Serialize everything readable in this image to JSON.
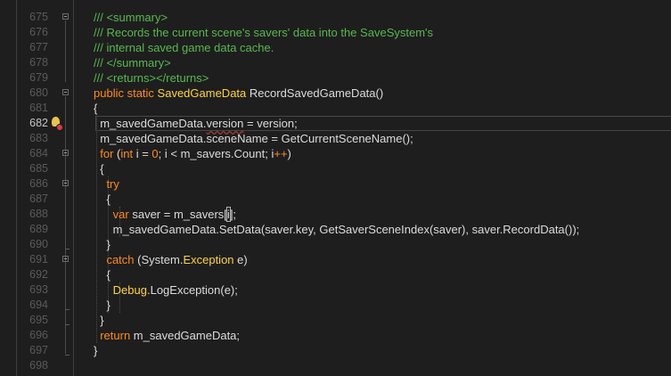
{
  "editor": {
    "line_numbers": [
      "675",
      "676",
      "677",
      "678",
      "679",
      "680",
      "681",
      "682",
      "683",
      "684",
      "685",
      "686",
      "687",
      "688",
      "689",
      "690",
      "691",
      "692",
      "693",
      "694",
      "695",
      "696",
      "697",
      "698"
    ],
    "current_line": "682",
    "lines": [
      {
        "tokens": [
          [
            "d",
            "/// <summary>"
          ]
        ]
      },
      {
        "tokens": [
          [
            "d",
            "/// Records the current scene's savers' data into the SaveSystem's"
          ]
        ]
      },
      {
        "tokens": [
          [
            "d",
            "/// internal saved game data cache."
          ]
        ]
      },
      {
        "tokens": [
          [
            "d",
            "/// </summary>"
          ]
        ]
      },
      {
        "tokens": [
          [
            "d",
            "/// <returns></returns>"
          ]
        ]
      },
      {
        "tokens": [
          [
            "k",
            "public static "
          ],
          [
            "t",
            "SavedGameData"
          ],
          [
            "n",
            " RecordSavedGameData()"
          ]
        ]
      },
      {
        "tokens": [
          [
            "n",
            "{"
          ]
        ]
      },
      {
        "tokens": [
          [
            "n",
            "  m_savedGameData."
          ],
          [
            "sq",
            "version"
          ],
          [
            "n",
            " = version;"
          ]
        ]
      },
      {
        "tokens": [
          [
            "n",
            "  m_savedGameData.sceneName = GetCurrentSceneName();"
          ]
        ]
      },
      {
        "tokens": [
          [
            "k",
            "  for"
          ],
          [
            "n",
            " ("
          ],
          [
            "k",
            "int"
          ],
          [
            "n",
            " i = "
          ],
          [
            "k",
            "0"
          ],
          [
            "n",
            "; i < m_savers.Count; i"
          ],
          [
            "k",
            "++"
          ],
          [
            "n",
            ")"
          ]
        ]
      },
      {
        "tokens": [
          [
            "n",
            "  {"
          ]
        ]
      },
      {
        "tokens": [
          [
            "k",
            "    try"
          ]
        ]
      },
      {
        "tokens": [
          [
            "n",
            "    {"
          ]
        ]
      },
      {
        "tokens": [
          [
            "k",
            "      var"
          ],
          [
            "n",
            " saver = m_savers["
          ],
          [
            "cur",
            "i"
          ],
          [
            "n",
            "];"
          ]
        ]
      },
      {
        "tokens": [
          [
            "n",
            "      m_savedGameData.SetData(saver.key, GetSaverSceneIndex(saver), saver.RecordData());"
          ]
        ]
      },
      {
        "tokens": [
          [
            "n",
            "    }"
          ]
        ]
      },
      {
        "tokens": [
          [
            "k",
            "    catch"
          ],
          [
            "n",
            " (System."
          ],
          [
            "t",
            "Exception"
          ],
          [
            "n",
            " e)"
          ]
        ]
      },
      {
        "tokens": [
          [
            "n",
            "    {"
          ]
        ]
      },
      {
        "tokens": [
          [
            "t",
            "      Debug"
          ],
          [
            "n",
            ".LogException(e);"
          ]
        ]
      },
      {
        "tokens": [
          [
            "n",
            "    }"
          ]
        ]
      },
      {
        "tokens": [
          [
            "n",
            "  }"
          ]
        ]
      },
      {
        "tokens": [
          [
            "k",
            "  return"
          ],
          [
            "n",
            " m_savedGameData;"
          ]
        ]
      },
      {
        "tokens": [
          [
            "n",
            "}"
          ]
        ]
      },
      {
        "tokens": [
          [
            "n",
            ""
          ]
        ]
      }
    ]
  },
  "icons": {
    "quick_action": "lightbulb-icon",
    "error_marker": "error-dot-icon"
  },
  "colors": {
    "background": "#1e1e1e",
    "keyword": "#ff8c1a",
    "type": "#ffd43b",
    "comment": "#58b94f",
    "text": "#dcdcdc",
    "line_number": "#5a5a5a"
  }
}
